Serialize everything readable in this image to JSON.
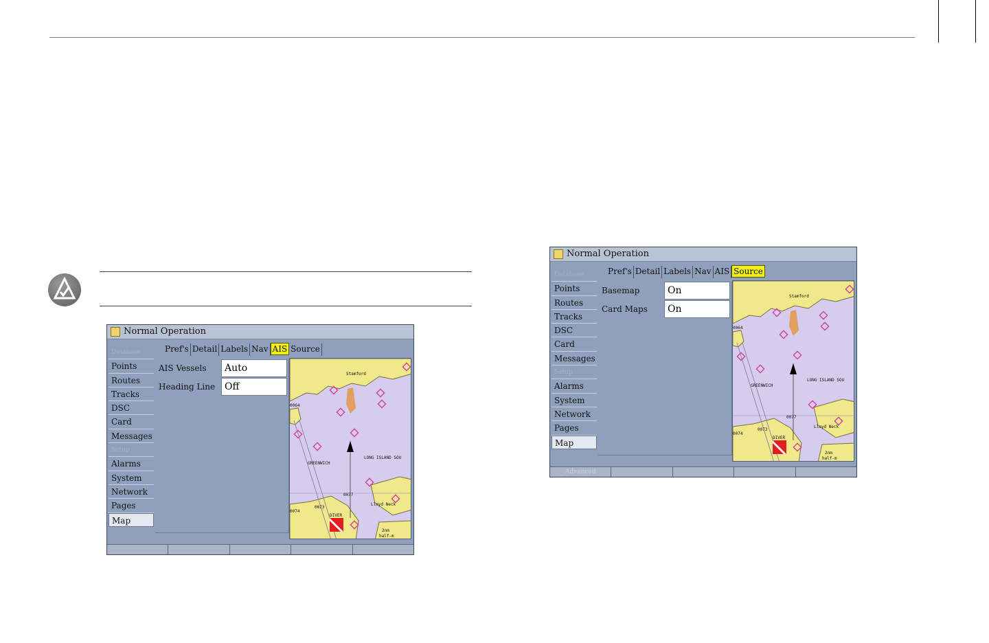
{
  "screen_left": {
    "title": "Normal Operation",
    "sidebar": [
      "Database",
      "Points",
      "Routes",
      "Tracks",
      "DSC",
      "Card",
      "Messages",
      "Setup",
      "Alarms",
      "System",
      "Network",
      "Pages",
      "Map"
    ],
    "tabs": [
      "Pref's",
      "Detail",
      "Labels",
      "Nav",
      "AIS",
      "Source"
    ],
    "settings": [
      {
        "label": "AIS Vessels",
        "value": "Auto"
      },
      {
        "label": "Heading Line",
        "value": "Off"
      }
    ],
    "softkeys": [
      "",
      "",
      "",
      "",
      ""
    ]
  },
  "screen_right": {
    "title": "Normal Operation",
    "sidebar": [
      "Database",
      "Points",
      "Routes",
      "Tracks",
      "DSC",
      "Card",
      "Messages",
      "Setup",
      "Alarms",
      "System",
      "Network",
      "Pages",
      "Map"
    ],
    "tabs": [
      "Pref's",
      "Detail",
      "Labels",
      "Nav",
      "AIS",
      "Source"
    ],
    "settings": [
      {
        "label": "Basemap",
        "value": "On"
      },
      {
        "label": "Card Maps",
        "value": "On"
      }
    ],
    "softkeys": [
      "Advanced",
      "",
      "",
      "",
      ""
    ]
  },
  "map_labels": {
    "town": "Stamford",
    "greenwich": "GREENWICH",
    "sound": "LONG ISLAND SOU",
    "neck": "Lloyd Neck",
    "zoom": "2nm",
    "zoom_unit": "half-m",
    "w1": "0064",
    "w2": "0077",
    "w3": "0073",
    "w4": "0074",
    "w5": "DIVER"
  },
  "colors": {
    "land": "#f1e88c",
    "water": "#d6ccee",
    "tab_active": "#f2ef18",
    "screen_bg": "#8ea0bb",
    "marker": "#d0409a"
  },
  "icons": [
    "note-icon",
    "map-tab-icon",
    "heading-arrow-icon",
    "diver-flag-icon"
  ]
}
